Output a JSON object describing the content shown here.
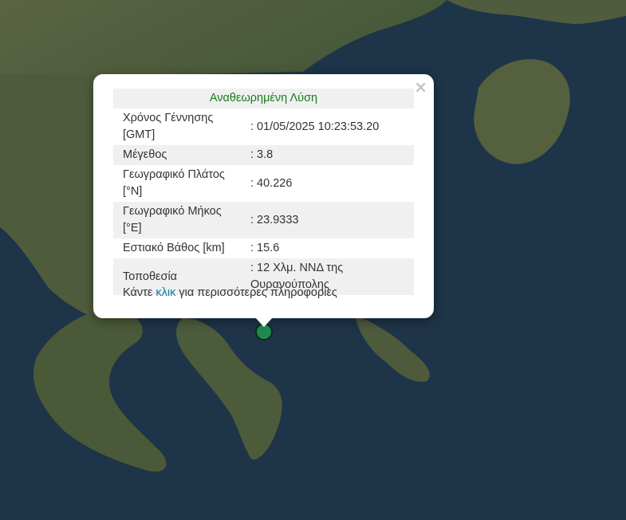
{
  "popup": {
    "title": "Αναθεωρημένη Λύση",
    "close_label": "×",
    "rows": [
      {
        "label_line1": "Χρόνος Γέννησης",
        "label_line2": "[GMT]",
        "value": ": 01/05/2025 10:23:53.20"
      },
      {
        "label": "Μέγεθος",
        "value": ": 3.8"
      },
      {
        "label_line1": "Γεωγραφικό Πλάτος",
        "label_line2": "[°N]",
        "value": ": 40.226"
      },
      {
        "label_line1": "Γεωγραφικό Μήκος",
        "label_line2": "[°E]",
        "value": ": 23.9333"
      },
      {
        "label": "Εστιακό Βάθος [km]",
        "value": ": 15.6"
      },
      {
        "label": "Τοποθεσία",
        "value_line1": ": 12 Χλμ. ΝΝΔ της",
        "value_line2": "Ουρανούπολης"
      }
    ],
    "more_prefix": "Κάντε ",
    "more_link": "κλικ",
    "more_suffix": " για περισσότερες πληροφορίες"
  },
  "marker": {
    "color": "#1e8a52"
  },
  "colors": {
    "title": "#1a7a1a",
    "link": "#0a7ea4",
    "sea": "#1d3347",
    "land": "#4a5a3a"
  }
}
